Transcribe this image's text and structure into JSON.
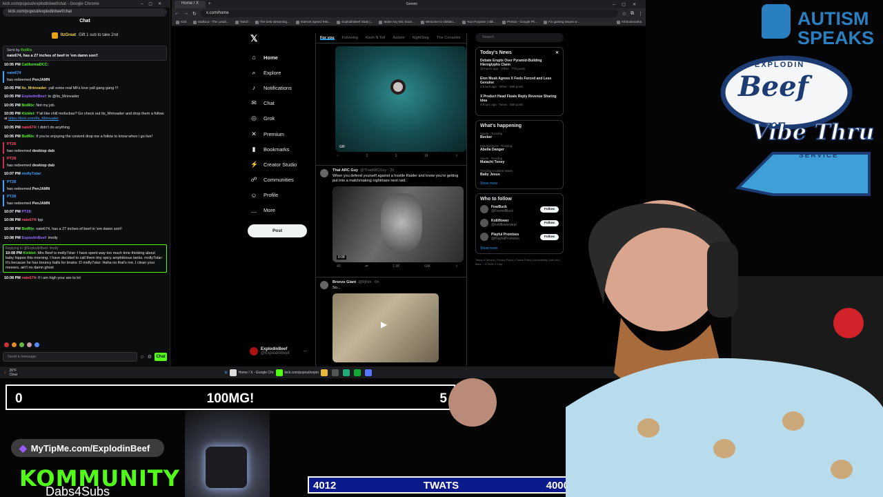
{
  "chat_window": {
    "title": "kick.com/popout/explodinbeef/chat - Google Chrome",
    "url": "kick.com/popout/explodinbeef/chat",
    "header": "Chat",
    "pinned": {
      "user": "ItzGreat",
      "text": "Gift 1 sub to take 2nd"
    },
    "sent_by": {
      "label": "Sent by",
      "user": "BotRix",
      "text": "nate674, has a 27 inches of beef in 'em damn son!!"
    },
    "messages": [
      {
        "type": "msg",
        "ts": "10:05 PM",
        "user": "CaliforniaDCC",
        "text": ""
      },
      {
        "type": "redeem",
        "user": "nate674",
        "text": "has redeemed",
        "reward": "PenJAMN",
        "red": false
      },
      {
        "type": "msg",
        "ts": "10:05 PM",
        "user": "Its_Mrinvader",
        "text": "yall some real MFs love yall gang gang !!!"
      },
      {
        "type": "msg",
        "ts": "10:05 PM",
        "user": "ExplodinBeef",
        "text": "to @Its_Mrinvader"
      },
      {
        "type": "msg",
        "ts": "10:05 PM",
        "user": "BotRix",
        "text": "Not my job."
      },
      {
        "type": "msg",
        "ts": "10:05 PM",
        "user": "Kicklet",
        "text": "Y'all like chill mofuckas? Go check out Its_Mrinvader and drop them a follow at ",
        "link": "https://kick.com/Its_Mrinvader"
      },
      {
        "type": "msg",
        "ts": "10:05 PM",
        "user": "nate674",
        "text": "I didn't do anything"
      },
      {
        "type": "msg",
        "ts": "10:05 PM",
        "user": "BotRix",
        "text": "If you're enjoying the content drop me a follow to know when i go live!"
      },
      {
        "type": "redeem",
        "user": "PT28",
        "text": "has redeemed",
        "reward": "desktop dab",
        "red": true
      },
      {
        "type": "redeem",
        "user": "PT28",
        "text": "has redeemed",
        "reward": "desktop dab",
        "red": true
      },
      {
        "type": "msg",
        "ts": "10:07 PM",
        "user": "molly7star",
        "text": ""
      },
      {
        "type": "redeem",
        "user": "PT28",
        "text": "has redeemed",
        "reward": "PenJAMN",
        "red": false
      },
      {
        "type": "redeem",
        "user": "PT28",
        "text": "has redeemed",
        "reward": "PenJAMN",
        "red": false
      },
      {
        "type": "msg",
        "ts": "10:07 PM",
        "user": "PT28",
        "text": ""
      },
      {
        "type": "msg",
        "ts": "10:08 PM",
        "user": "nate674",
        "text": "lpp"
      },
      {
        "type": "msg",
        "ts": "10:08 PM",
        "user": "BotRix",
        "text": "nate674, has a 27 inches of beef in 'em damn son!!"
      },
      {
        "type": "msg",
        "ts": "10:08 PM",
        "user": "ExplodinBeef",
        "text": "lmolly"
      },
      {
        "type": "reply",
        "head": "Replying to @ExplodinBeef: lmolly",
        "ts": "10:08 PM",
        "user": "Kicklet",
        "text": "Mrs Beef is molly7star: I have spent way too much time thinking about baby hippos this morning. I have decided to call them tiny spicy amphibious tanks. molly7star: It's because he has bouncy balls for brains :D molly7star: Haha no that's me..I clean your messes, ain't no damn ghost"
      },
      {
        "type": "msg",
        "ts": "10:08 PM",
        "user": "nate674",
        "text": "If i am high your are to lol"
      }
    ],
    "send_placeholder": "Send a message",
    "chat_button": "Chat"
  },
  "browser": {
    "tab_title": "Home / X",
    "url": "x.com/home",
    "bookmarks": [
      "Kick",
      "Stalkout - The Leadi...",
      "Twitch",
      "The best streaming...",
      "Internet Speed Test...",
      "ExplodinBeef Stats |...",
      "Make Any Mic Soun...",
      "Welcome to Obliato...",
      "Your Purpose | obli...",
      "Photos - Google Ph...",
      "Fix gaming issues w..."
    ],
    "all_bookmarks": "All Bookmarks",
    "gemini": "Gemini",
    "nav": [
      {
        "icon": "home-icon",
        "glyph": "⌂",
        "label": "Home",
        "active": true
      },
      {
        "icon": "search-icon",
        "glyph": "⌕",
        "label": "Explore"
      },
      {
        "icon": "bell-icon",
        "glyph": "♪",
        "label": "Notifications"
      },
      {
        "icon": "chat-icon",
        "glyph": "✉",
        "label": "Chat"
      },
      {
        "icon": "grok-icon",
        "glyph": "◎",
        "label": "Grok"
      },
      {
        "icon": "premium-icon",
        "glyph": "✕",
        "label": "Premium"
      },
      {
        "icon": "bookmark-icon",
        "glyph": "▮",
        "label": "Bookmarks"
      },
      {
        "icon": "creator-icon",
        "glyph": "⚡",
        "label": "Creator Studio"
      },
      {
        "icon": "communities-icon",
        "glyph": "☍",
        "label": "Communities"
      },
      {
        "icon": "profile-icon",
        "glyph": "☺",
        "label": "Profile"
      },
      {
        "icon": "more-icon",
        "glyph": "…",
        "label": "More"
      }
    ],
    "post_button": "Post",
    "me": {
      "name": "ExplodinBeef",
      "handle": "@ExplodinBeef"
    },
    "feed_tabs": [
      "For you",
      "Following",
      "Kosh N Tell",
      "Autism",
      "NightStep",
      "The Consoles"
    ],
    "posted_pill": "posted",
    "tweets": [
      {
        "name": "",
        "handle": "",
        "text": "",
        "gif": "GIF",
        "acts": [
          "",
          "2",
          "2",
          "18",
          ""
        ]
      },
      {
        "name": "That ARC Guy",
        "handle": "@ThatARCGuy · 2h",
        "text": "When you defend yourself against a hostile Raider and know you're getting put into a matchmaking nightmare next raid.",
        "dur": "0:08",
        "acts": [
          "40",
          "",
          "1.9K",
          "64K",
          ""
        ]
      },
      {
        "name": "Bronze Giant",
        "handle": "@RjNoi · 6h",
        "text": "So..."
      }
    ],
    "search_placeholder": "Search",
    "news": {
      "title": "Today's News",
      "items": [
        {
          "h": "Debate Erupts Over Pyramid-Building Hieroglyphs Claim",
          "m": "10 hours ago · Other · 776 posts"
        },
        {
          "h": "Elon Musk Agrees X Feels Forced and Less Genuine",
          "m": "2 hours ago · Other · 598 posts"
        },
        {
          "h": "X Product Head Floats Reply Revenue Sharing Idea",
          "m": "4 hours ago · News · 559 posts"
        }
      ]
    },
    "happening": {
      "title": "What's happening",
      "items": [
        {
          "c": "Sports · Trending",
          "t": "Becker"
        },
        {
          "c": "Entertainment · Trending",
          "t": "Abella Danger"
        },
        {
          "c": "Sports · Trending",
          "t": "Malachi Toney"
        },
        {
          "c": "Trending in United States",
          "t": "Baby Jesus"
        }
      ],
      "show_more": "Show more"
    },
    "who": {
      "title": "Who to follow",
      "items": [
        {
          "n": "FearBuck",
          "h": "@FearedBuck",
          "b": "Follow"
        },
        {
          "n": "Kolliflower",
          "h": "@kolliflowerdept",
          "b": "Follow"
        },
        {
          "n": "Playful Promises",
          "h": "@PlayfulPromises",
          "b": "Follow"
        }
      ],
      "show_more": "Show more"
    },
    "footer": "Terms of Service | Privacy Policy | Cookie Policy | Accessibility | Ads info | More ... © 2025 X Corp."
  },
  "taskbar": {
    "weather": "26°F",
    "weather2": "Clear",
    "items": [
      "Home / X - Google Chr",
      "kick.com/popout/explo"
    ]
  },
  "overlay": {
    "goal": {
      "left": "0",
      "center": "100MG!",
      "right": "5"
    },
    "tip": "MyTipMe.com/ExplodinBeef",
    "kommunity": "KOMMUNITY",
    "kommunity_sub": "Dabs4Subs",
    "subbar": {
      "left": "4012",
      "center": "TWATS",
      "right": "4000"
    },
    "autism": {
      "l1": "AUTISM",
      "l2": "SPEAKS"
    },
    "beef": {
      "top": "EXPLODIN",
      "name": "Beef",
      "l2": "Vibe Thru",
      "service": "SERVICE"
    }
  }
}
